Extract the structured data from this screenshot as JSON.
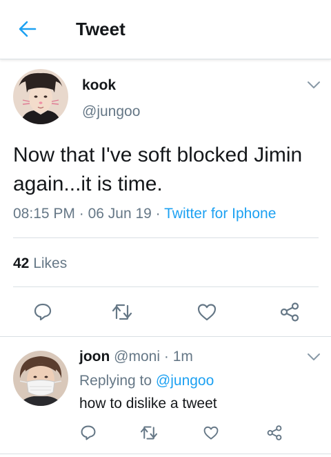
{
  "header": {
    "title": "Tweet"
  },
  "tweet": {
    "name": "kook",
    "handle": "@jungoo",
    "text": "Now that I've soft blocked Jimin again...it is time.",
    "time": "08:15 PM",
    "sep1": "·",
    "date": "06 Jun 19",
    "sep2": "·",
    "source": "Twitter for Iphone",
    "likes_count": "42",
    "likes_label": "Likes"
  },
  "reply": {
    "name": "joon",
    "handle": "@moni",
    "sep": "·",
    "time": "1m",
    "replying_prefix": "Replying to",
    "replying_to": "@jungoo",
    "text": "how to dislike a tweet"
  },
  "colors": {
    "accent": "#1da1f2",
    "secondary_text": "#657786",
    "divider": "#d9dfe3"
  },
  "icons": [
    "back-arrow-icon",
    "chevron-down-icon",
    "reply-icon",
    "retweet-icon",
    "heart-icon",
    "share-icon"
  ]
}
